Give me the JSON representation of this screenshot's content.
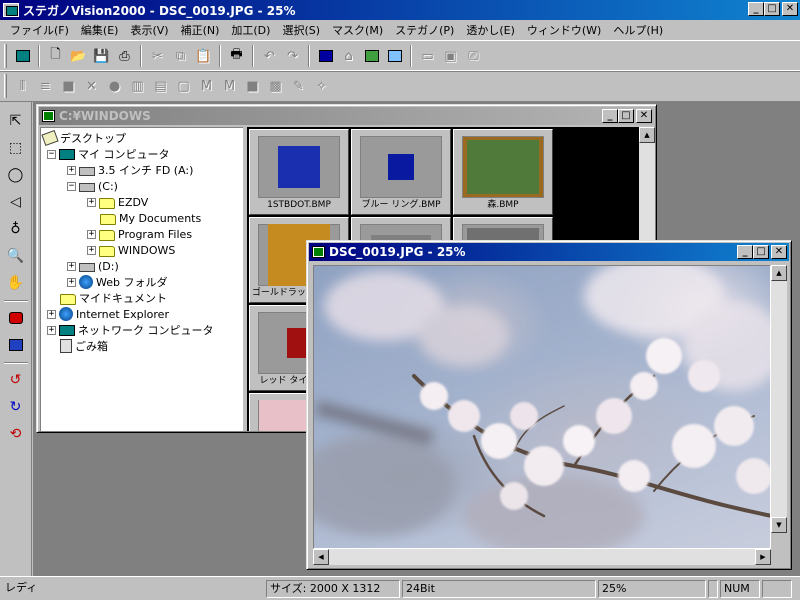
{
  "window": {
    "title": "ステガノVision2000 - DSC_0019.JPG - 25%"
  },
  "menu": [
    "ファイル(F)",
    "編集(E)",
    "表示(V)",
    "補正(N)",
    "加工(D)",
    "選択(S)",
    "マスク(M)",
    "ステガノ(P)",
    "透かし(E)",
    "ウィンドウ(W)",
    "ヘルプ(H)"
  ],
  "explorer": {
    "title": "C:¥WINDOWS",
    "tree": {
      "desktop": "デスクトップ",
      "my_computer": "マイ コンピュータ",
      "floppy": "3.5 インチ FD (A:)",
      "c_drive": "(C:)",
      "ezdv": "EZDV",
      "my_documents": "My Documents",
      "program_files": "Program Files",
      "windows": "WINDOWS",
      "d_drive": "(D:)",
      "web_folder": "Web フォルダ",
      "my_docs_jp": "マイドキュメント",
      "ie": "Internet Explorer",
      "network": "ネットワーク コンピュータ",
      "recycle": "ごみ箱"
    },
    "thumbnails": [
      {
        "label": "1STBDOT.BMP",
        "color": "#1a2fb0"
      },
      {
        "label": "ブルー リング.BMP",
        "color": "#0a1aa0"
      },
      {
        "label": "森.BMP",
        "color": "#4f7a3a"
      },
      {
        "label": "ゴールドラッシュ.BMP",
        "color": "#c58a20"
      },
      {
        "label": "",
        "color": "#808080"
      },
      {
        "label": "",
        "color": "#707070"
      },
      {
        "label": "レッド タイル.BMP",
        "color": "#a01010"
      },
      {
        "label": "",
        "color": "#e8c0c8"
      }
    ]
  },
  "image_window": {
    "title": "DSC_0019.JPG - 25%"
  },
  "status": {
    "ready": "レディ",
    "size": "サイズ: 2000 X 1312",
    "bits": "24Bit",
    "zoom": "25%",
    "num": "NUM"
  }
}
